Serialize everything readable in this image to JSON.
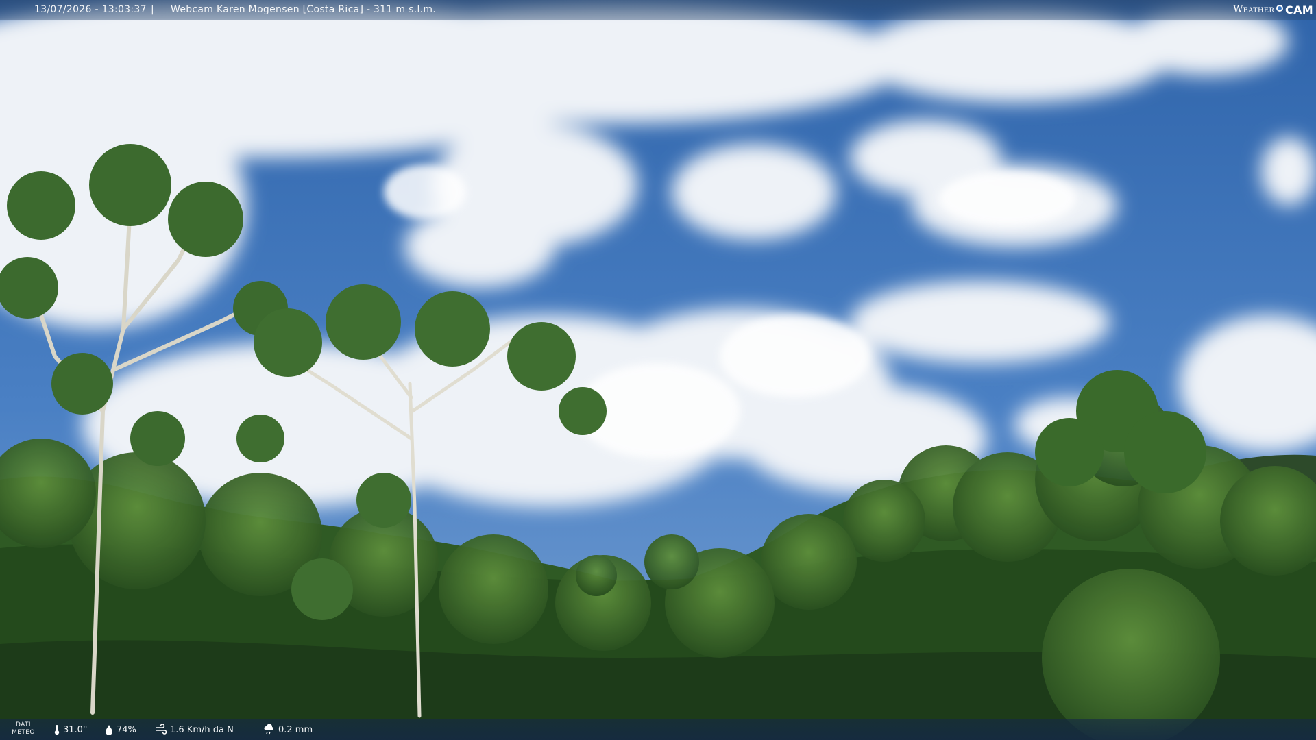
{
  "overlay": {
    "timestamp": "13/07/2026 - 13:03:37",
    "separator": "|",
    "camera_label": "Webcam Karen Mogensen [Costa Rica] - 311 m s.l.m.",
    "brand": {
      "weather": "Weather",
      "cam": "CAM"
    }
  },
  "weather_data": {
    "section_label_line1": "DATI",
    "section_label_line2": "METEO",
    "temperature": "31.0°",
    "humidity": "74%",
    "wind": "1.6 Km/h da N",
    "rain": "0.2 mm"
  },
  "icons": {
    "temperature": "thermometer-icon",
    "humidity": "drop-icon",
    "wind": "wind-icon",
    "rain": "rain-cloud-icon",
    "brand_dot": "globe-dot-icon"
  },
  "colors": {
    "sky_top": "#2e62a8",
    "sky_mid": "#4a80c4",
    "cloud": "#f2f5f8",
    "forest_dark": "#1d3b19",
    "forest_mid": "#2f5a24",
    "forest_light": "#4f7d34"
  }
}
